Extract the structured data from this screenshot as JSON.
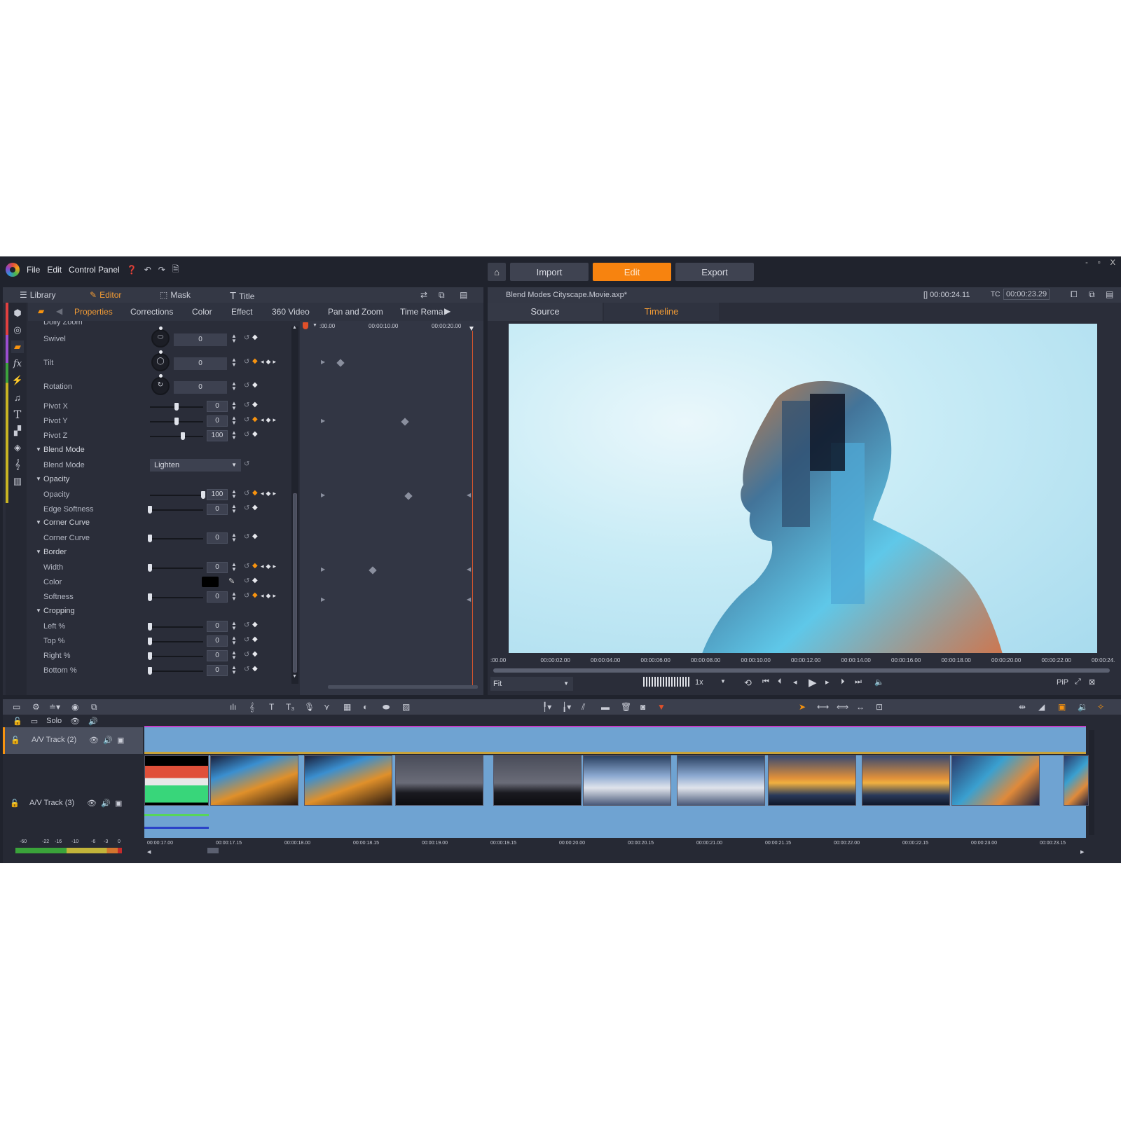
{
  "titlebar": {
    "menu": [
      "File",
      "Edit",
      "Control Panel"
    ],
    "icons": [
      "help-icon",
      "undo-icon",
      "redo-icon",
      "document-icon"
    ],
    "nav": {
      "import": "Import",
      "edit": "Edit",
      "export": "Export"
    },
    "window_controls": [
      "-",
      "▫",
      "X"
    ],
    "accent": "#f7830f"
  },
  "left_panel": {
    "tabs": [
      {
        "label": "Library",
        "icon": "library-icon"
      },
      {
        "label": "Editor",
        "icon": "editor-icon",
        "active": true
      },
      {
        "label": "Mask",
        "icon": "mask-icon"
      },
      {
        "label": "Title",
        "icon": "title-icon"
      }
    ],
    "subtabs": [
      "Properties",
      "Corrections",
      "Color",
      "Effect",
      "360 Video",
      "Pan and Zoom",
      "Time Rema"
    ],
    "active_subtab": "Properties",
    "sidebar_icons": [
      "library-box-icon",
      "film-reel-icon",
      "folder-icon",
      "fx-icon",
      "lightning-icon",
      "music-icon",
      "text-icon",
      "transition-icon",
      "layers-icon",
      "treble-clef-icon",
      "piano-icon"
    ],
    "properties": {
      "cut_off": "Dolly Zoom",
      "swivel": {
        "label": "Swivel",
        "value": "0"
      },
      "tilt": {
        "label": "Tilt",
        "value": "0"
      },
      "rotation": {
        "label": "Rotation",
        "value": "0"
      },
      "pivot_x": {
        "label": "Pivot X",
        "value": "0",
        "pos": 0.5
      },
      "pivot_y": {
        "label": "Pivot Y",
        "value": "0",
        "pos": 0.5
      },
      "pivot_z": {
        "label": "Pivot Z",
        "value": "100",
        "pos": 0.62
      },
      "blend_section": "Blend Mode",
      "blend_mode": {
        "label": "Blend Mode",
        "value": "Lighten"
      },
      "opacity_section": "Opacity",
      "opacity": {
        "label": "Opacity",
        "value": "100",
        "pos": 1.0
      },
      "edge_softness": {
        "label": "Edge Softness",
        "value": "0",
        "pos": 0
      },
      "corner_section": "Corner Curve",
      "corner_curve": {
        "label": "Corner Curve",
        "value": "0",
        "pos": 0
      },
      "border_section": "Border",
      "width": {
        "label": "Width",
        "value": "0",
        "pos": 0
      },
      "color": {
        "label": "Color",
        "value": "#000000"
      },
      "softness": {
        "label": "Softness",
        "value": "0",
        "pos": 0
      },
      "cropping_section": "Cropping",
      "left": {
        "label": "Left %",
        "value": "0",
        "pos": 0
      },
      "top": {
        "label": "Top %",
        "value": "0",
        "pos": 0
      },
      "right": {
        "label": "Right %",
        "value": "0",
        "pos": 0
      },
      "bottom": {
        "label": "Bottom %",
        "value": "0",
        "pos": 0
      }
    },
    "keyframe_ruler": [
      ":00.00",
      "00:00:10.00",
      "00:00:20.00"
    ]
  },
  "right_panel": {
    "project_name": "Blend Modes Cityscape.Movie.axp*",
    "duration": "[] 00:00:24.11",
    "tc_label": "TC",
    "timecode": "00:00:23.29",
    "tabs": [
      "Source",
      "Timeline"
    ],
    "active_tab": "Timeline",
    "ruler": [
      ":00.00",
      "00:00:02.00",
      "00:00:04.00",
      "00:00:06.00",
      "00:00:08.00",
      "00:00:10.00",
      "00:00:12.00",
      "00:00:14.00",
      "00:00:16.00",
      "00:00:18.00",
      "00:00:20.00",
      "00:00:22.00",
      "00:00:24."
    ],
    "zoom_select": "Fit",
    "speed": "1x",
    "pip_label": "PiP",
    "transport": [
      "loop-icon",
      "go-to-start-icon",
      "prev-marker-icon",
      "step-back-icon",
      "play-icon",
      "step-forward-icon",
      "next-marker-icon",
      "go-to-end-icon",
      "volume-icon"
    ]
  },
  "timeline": {
    "toolbar_left": [
      "storyboard-icon",
      "settings-icon",
      "track-options-icon",
      "disc-icon",
      "export-icon"
    ],
    "toolbar_mid": [
      "audio-mixer-icon",
      "music-score-icon",
      "title-icon",
      "title-3d-icon",
      "microphone-icon",
      "transition-icon",
      "multicam-icon",
      "color-icon",
      "blend-icon",
      "motion-icon"
    ],
    "toolbar_right1": [
      "split-icon",
      "split2-icon",
      "razor-icon",
      "clip-icon",
      "trash-icon",
      "snapshot-icon",
      "marker-icon"
    ],
    "toolbar_right2": [
      "pointer-icon",
      "ripple-icon",
      "slip-icon",
      "slide-icon",
      "fit-icon"
    ],
    "toolbar_far": [
      "magnet-icon",
      "audio-duck-icon",
      "scrub-icon",
      "voiceover-icon",
      "magic-icon"
    ],
    "solo_label": "Solo",
    "tracks": [
      {
        "name": "A/V Track (2)"
      },
      {
        "name": "A/V Track (3)"
      }
    ],
    "ruler": [
      "00:00:17.00",
      "00:00:17.15",
      "00:00:18.00",
      "00:00:18.15",
      "00:00:19.00",
      "00:00:19.15",
      "00:00:20.00",
      "00:00:20.15",
      "00:00:21.00",
      "00:00:21.15",
      "00:00:22.00",
      "00:00:22.15",
      "00:00:23.00",
      "00:00:23.15"
    ],
    "meter_ticks": [
      "-60",
      "-22",
      "-16",
      "-10",
      "-6",
      "-3",
      "0"
    ],
    "clips": [
      "audio-visualizer",
      "night-street",
      "night-street",
      "milky-way",
      "milky-way",
      "crosswalk",
      "crosswalk",
      "sunset",
      "sunset",
      "city-aerial",
      "city-aerial"
    ]
  }
}
